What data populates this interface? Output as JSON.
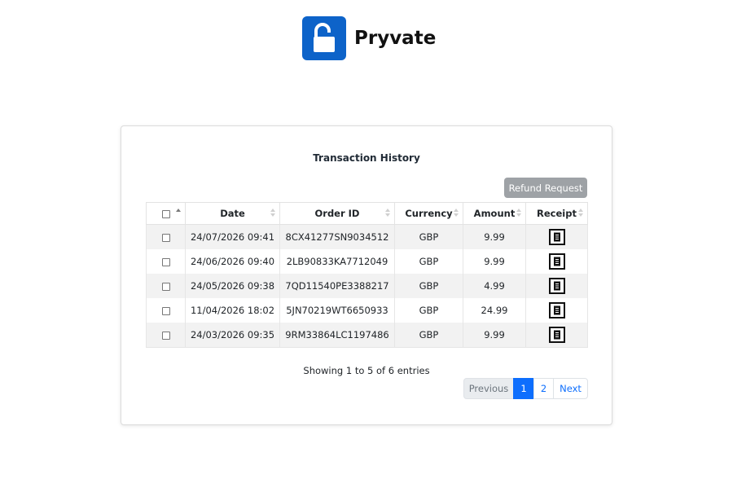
{
  "brand": {
    "name": "Pryvate",
    "logo_color": "#0d63c9",
    "logo_icon": "unlocked-padlock-icon"
  },
  "card": {
    "title": "Transaction History",
    "refund_button_label": "Refund Request",
    "refund_button_color": "#9ea2a6"
  },
  "table": {
    "columns": [
      "Date",
      "Order ID",
      "Currency",
      "Amount",
      "Receipt"
    ],
    "rows": [
      {
        "date": "24/07/2026 09:41",
        "order_id": "8CX41277SN9034512",
        "currency": "GBP",
        "amount": "9.99"
      },
      {
        "date": "24/06/2026 09:40",
        "order_id": "2LB90833KA7712049",
        "currency": "GBP",
        "amount": "9.99"
      },
      {
        "date": "24/05/2026 09:38",
        "order_id": "7QD11540PE3388217",
        "currency": "GBP",
        "amount": "4.99"
      },
      {
        "date": "11/04/2026 18:02",
        "order_id": "5JN70219WT6650933",
        "currency": "GBP",
        "amount": "24.99"
      },
      {
        "date": "24/03/2026 09:35",
        "order_id": "9RM33864LC1197486",
        "currency": "GBP",
        "amount": "9.99"
      }
    ],
    "receipt_icon": "receipt-icon"
  },
  "footer": {
    "info": "Showing 1 to 5 of 6 entries",
    "pagination": {
      "previous": "Previous",
      "pages": [
        "1",
        "2"
      ],
      "current_page": "1",
      "next": "Next",
      "active_color": "#0d6efd"
    }
  }
}
